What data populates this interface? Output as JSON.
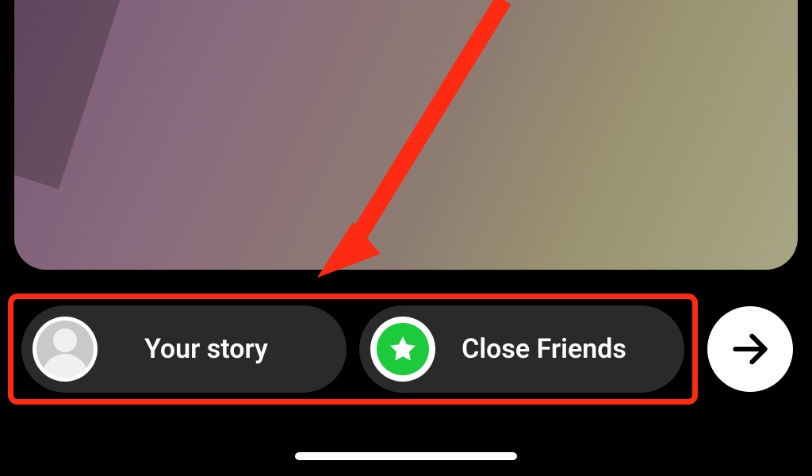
{
  "share": {
    "your_story_label": "Your story",
    "close_friends_label": "Close Friends"
  },
  "annotation": {
    "highlight_color": "#ff2a12",
    "close_friends_accent": "#1bcb3b"
  }
}
